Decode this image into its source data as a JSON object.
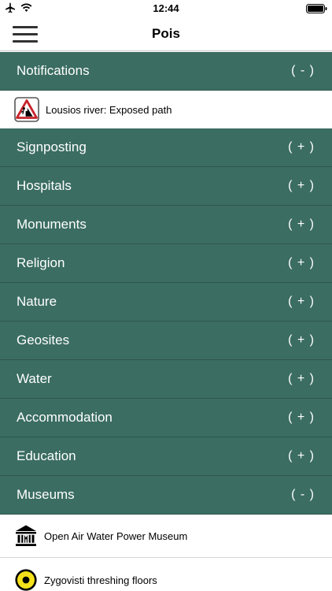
{
  "status": {
    "time": "12:44"
  },
  "nav": {
    "title": "Pois"
  },
  "sections": [
    {
      "label": "Notifications",
      "toggle": "( - )"
    },
    {
      "label": "Signposting",
      "toggle": "( + )"
    },
    {
      "label": "Hospitals",
      "toggle": "( + )"
    },
    {
      "label": "Monuments",
      "toggle": "( + )"
    },
    {
      "label": "Religion",
      "toggle": "( + )"
    },
    {
      "label": "Nature",
      "toggle": "( + )"
    },
    {
      "label": "Geosites",
      "toggle": "( + )"
    },
    {
      "label": "Water",
      "toggle": "( + )"
    },
    {
      "label": "Accommodation",
      "toggle": "( + )"
    },
    {
      "label": "Education",
      "toggle": "( + )"
    },
    {
      "label": "Museums",
      "toggle": "( - )"
    }
  ],
  "notifications_items": [
    {
      "label": "Lousios river: Exposed path",
      "icon": "warning-cliff-icon"
    }
  ],
  "museums_items": [
    {
      "label": "Open Air Water Power Museum",
      "icon": "museum-icon"
    },
    {
      "label": "Zygovisti threshing floors",
      "icon": "yellow-target-icon"
    }
  ],
  "colors": {
    "section_bg": "#3b6d62",
    "warning": "#c8252c",
    "marker": "#f4e11b"
  }
}
